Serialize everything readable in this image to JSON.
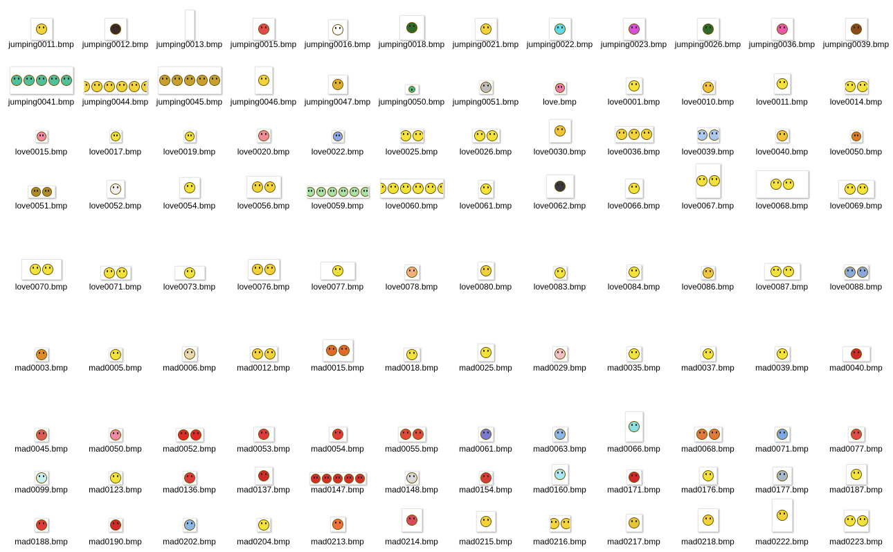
{
  "icons": {
    "file_thumbnail": "smiley-icon"
  },
  "files": [
    {
      "name": "jumping0011.bmp",
      "color": "#f2d43a"
    },
    {
      "name": "jumping0012.bmp",
      "color": "#3a2a2a"
    },
    {
      "name": "jumping0013.bmp",
      "color": "#ffffff"
    },
    {
      "name": "jumping0015.bmp",
      "color": "#e24a4a"
    },
    {
      "name": "jumping0016.bmp",
      "color": "#ffffff"
    },
    {
      "name": "jumping0018.bmp",
      "color": "#2f6a2a"
    },
    {
      "name": "jumping0021.bmp",
      "color": "#f2d43a"
    },
    {
      "name": "jumping0022.bmp",
      "color": "#5fd9e6"
    },
    {
      "name": "jumping0023.bmp",
      "color": "#d94fd9"
    },
    {
      "name": "jumping0026.bmp",
      "color": "#2f6a2a"
    },
    {
      "name": "jumping0036.bmp",
      "color": "#e85aa8"
    },
    {
      "name": "jumping0039.bmp",
      "color": "#8a4a1a"
    },
    {
      "name": "jumping0041.bmp",
      "color": "#4fc09a"
    },
    {
      "name": "jumping0044.bmp",
      "color": "#f2d43a"
    },
    {
      "name": "jumping0045.bmp",
      "color": "#c8a030"
    },
    {
      "name": "jumping0046.bmp",
      "color": "#f2d43a"
    },
    {
      "name": "jumping0047.bmp",
      "color": "#e0b030"
    },
    {
      "name": "jumping0050.bmp",
      "color": "#3fc07a"
    },
    {
      "name": "jumping0051.bmp",
      "color": "#bdbdbd"
    },
    {
      "name": "love.bmp",
      "color": "#f07aa8"
    },
    {
      "name": "love0001.bmp",
      "color": "#f2e23a"
    },
    {
      "name": "love0010.bmp",
      "color": "#f2c43a"
    },
    {
      "name": "love0011.bmp",
      "color": "#f2e23a"
    },
    {
      "name": "love0014.bmp",
      "color": "#f2e23a"
    },
    {
      "name": "love0015.bmp",
      "color": "#f28aa8"
    },
    {
      "name": "love0017.bmp",
      "color": "#f2e23a"
    },
    {
      "name": "love0019.bmp",
      "color": "#f2e23a"
    },
    {
      "name": "love0020.bmp",
      "color": "#f28a9a"
    },
    {
      "name": "love0022.bmp",
      "color": "#8aa8f0"
    },
    {
      "name": "love0025.bmp",
      "color": "#f2e23a"
    },
    {
      "name": "love0026.bmp",
      "color": "#f2e23a"
    },
    {
      "name": "love0030.bmp",
      "color": "#f2c43a"
    },
    {
      "name": "love0036.bmp",
      "color": "#f2d43a"
    },
    {
      "name": "love0039.bmp",
      "color": "#a8c8f0"
    },
    {
      "name": "love0040.bmp",
      "color": "#f2c43a"
    },
    {
      "name": "love0050.bmp",
      "color": "#e07a2a"
    },
    {
      "name": "love0051.bmp",
      "color": "#b08a2a"
    },
    {
      "name": "love0052.bmp",
      "color": "#f0f0f0"
    },
    {
      "name": "love0054.bmp",
      "color": "#f2e23a"
    },
    {
      "name": "love0056.bmp",
      "color": "#f2d43a"
    },
    {
      "name": "love0059.bmp",
      "color": "#a8e0a8"
    },
    {
      "name": "love0060.bmp",
      "color": "#f2e23a"
    },
    {
      "name": "love0061.bmp",
      "color": "#f2e23a"
    },
    {
      "name": "love0062.bmp",
      "color": "#3a3a3a"
    },
    {
      "name": "love0066.bmp",
      "color": "#f2e23a"
    },
    {
      "name": "love0067.bmp",
      "color": "#f2e23a"
    },
    {
      "name": "love0068.bmp",
      "color": "#f2e23a"
    },
    {
      "name": "love0069.bmp",
      "color": "#f2e23a"
    },
    {
      "name": "love0070.bmp",
      "color": "#f2e23a"
    },
    {
      "name": "love0071.bmp",
      "color": "#f2e23a"
    },
    {
      "name": "love0073.bmp",
      "color": "#f2e23a"
    },
    {
      "name": "love0076.bmp",
      "color": "#f2d43a"
    },
    {
      "name": "love0077.bmp",
      "color": "#f2e23a"
    },
    {
      "name": "love0078.bmp",
      "color": "#f2b07a"
    },
    {
      "name": "love0080.bmp",
      "color": "#f2d43a"
    },
    {
      "name": "love0083.bmp",
      "color": "#f2e23a"
    },
    {
      "name": "love0084.bmp",
      "color": "#f2e23a"
    },
    {
      "name": "love0086.bmp",
      "color": "#f2c43a"
    },
    {
      "name": "love0087.bmp",
      "color": "#f2e23a"
    },
    {
      "name": "love0088.bmp",
      "color": "#8aa8d8"
    },
    {
      "name": "mad0003.bmp",
      "color": "#e08a2a"
    },
    {
      "name": "mad0005.bmp",
      "color": "#f2e23a"
    },
    {
      "name": "mad0006.bmp",
      "color": "#e8d8b0"
    },
    {
      "name": "mad0012.bmp",
      "color": "#f2d43a"
    },
    {
      "name": "mad0015.bmp",
      "color": "#e06a2a"
    },
    {
      "name": "mad0018.bmp",
      "color": "#f2e23a"
    },
    {
      "name": "mad0025.bmp",
      "color": "#f2e23a"
    },
    {
      "name": "mad0029.bmp",
      "color": "#f0c0c0"
    },
    {
      "name": "mad0035.bmp",
      "color": "#f2e23a"
    },
    {
      "name": "mad0037.bmp",
      "color": "#f2e23a"
    },
    {
      "name": "mad0039.bmp",
      "color": "#f2e23a"
    },
    {
      "name": "mad0040.bmp",
      "color": "#d02a2a"
    },
    {
      "name": "mad0045.bmp",
      "color": "#e05a5a"
    },
    {
      "name": "mad0050.bmp",
      "color": "#f08aa0"
    },
    {
      "name": "mad0052.bmp",
      "color": "#e02a2a"
    },
    {
      "name": "mad0053.bmp",
      "color": "#e03a3a"
    },
    {
      "name": "mad0054.bmp",
      "color": "#e03a3a"
    },
    {
      "name": "mad0055.bmp",
      "color": "#e04a3a"
    },
    {
      "name": "mad0061.bmp",
      "color": "#7a7ad8"
    },
    {
      "name": "mad0063.bmp",
      "color": "#8ab8e8"
    },
    {
      "name": "mad0066.bmp",
      "color": "#8ae0e0"
    },
    {
      "name": "mad0068.bmp",
      "color": "#e07a3a"
    },
    {
      "name": "mad0071.bmp",
      "color": "#7aa8e8"
    },
    {
      "name": "mad0077.bmp",
      "color": "#e04a4a"
    },
    {
      "name": "mad0099.bmp",
      "color": "#c8f0f0"
    },
    {
      "name": "mad0123.bmp",
      "color": "#f2e23a"
    },
    {
      "name": "mad0136.bmp",
      "color": "#e03a3a"
    },
    {
      "name": "mad0137.bmp",
      "color": "#d02a2a"
    },
    {
      "name": "mad0147.bmp",
      "color": "#e02a2a"
    },
    {
      "name": "mad0148.bmp",
      "color": "#d8d8d8"
    },
    {
      "name": "mad0154.bmp",
      "color": "#d83a3a"
    },
    {
      "name": "mad0160.bmp",
      "color": "#a8e8f0"
    },
    {
      "name": "mad0171.bmp",
      "color": "#d02a2a"
    },
    {
      "name": "mad0176.bmp",
      "color": "#f2e23a"
    },
    {
      "name": "mad0177.bmp",
      "color": "#a8b8c8"
    },
    {
      "name": "mad0187.bmp",
      "color": "#f2e23a"
    },
    {
      "name": "mad0188.bmp",
      "color": "#e03a3a"
    },
    {
      "name": "mad0190.bmp",
      "color": "#d02a2a"
    },
    {
      "name": "mad0202.bmp",
      "color": "#8ab8e8"
    },
    {
      "name": "mad0204.bmp",
      "color": "#f2e23a"
    },
    {
      "name": "mad0213.bmp",
      "color": "#f0703a"
    },
    {
      "name": "mad0214.bmp",
      "color": "#d84a5a"
    },
    {
      "name": "mad0215.bmp",
      "color": "#f2d43a"
    },
    {
      "name": "mad0216.bmp",
      "color": "#f2d43a"
    },
    {
      "name": "mad0217.bmp",
      "color": "#e8c43a"
    },
    {
      "name": "mad0218.bmp",
      "color": "#f2d43a"
    },
    {
      "name": "mad0222.bmp",
      "color": "#f2d43a"
    },
    {
      "name": "mad0223.bmp",
      "color": "#f2e23a"
    }
  ]
}
